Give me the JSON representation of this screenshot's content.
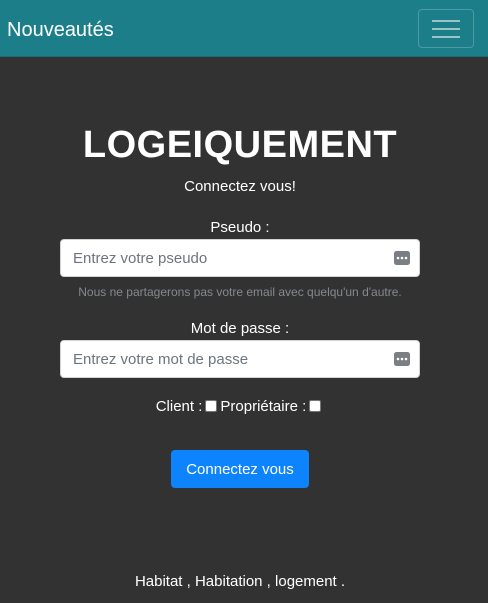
{
  "navbar": {
    "brand": "Nouveautés",
    "toggler_icon": "hamburger-icon",
    "color": "#1b7e89"
  },
  "form": {
    "title": "LOGEIQUEMENT",
    "subtitle": "Connectez vous!",
    "pseudo_label": "Pseudo :",
    "pseudo_placeholder": "Entrez votre pseudo",
    "pseudo_help": "Nous ne partagerons pas votre email avec quelqu'un d'autre.",
    "password_label": "Mot de passe :",
    "password_placeholder": "Entrez votre mot de passe",
    "role_client": "Client :",
    "role_owner": "Propriétaire :",
    "client_checked": false,
    "owner_checked": false,
    "submit_label": "Connectez vous",
    "submit_color": "#0d84fe"
  },
  "footer": {
    "text": "Habitat , Habitation , logement ."
  },
  "colors": {
    "background": "#323232"
  }
}
